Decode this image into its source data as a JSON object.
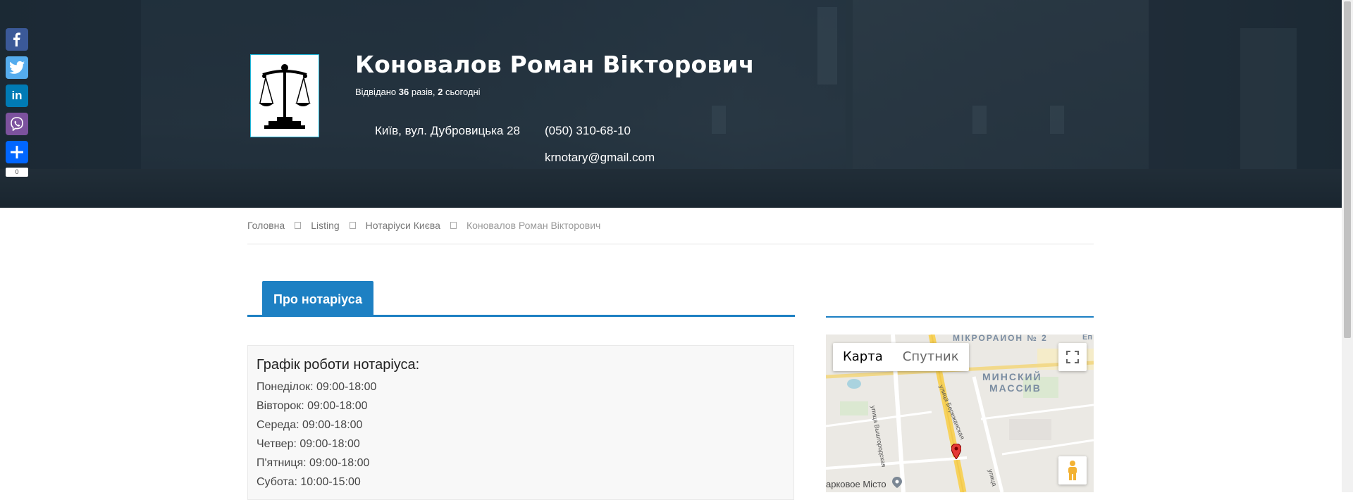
{
  "header": {
    "title": "Коновалов Роман Вікторович",
    "visits_prefix": "Відвідано ",
    "visits_total": "36",
    "visits_mid": " разів, ",
    "visits_today": "2",
    "visits_suffix": " сьогодні",
    "address": "Київ, вул. Дубровицька 28",
    "phone": "(050) 310-68-10",
    "email": "krnotary@gmail.com"
  },
  "social": {
    "buttons": [
      {
        "name": "facebook",
        "color": "#3b5998",
        "glyph": "f"
      },
      {
        "name": "twitter",
        "color": "#55acee",
        "glyph": "t"
      },
      {
        "name": "linkedin",
        "color": "#007bb5",
        "glyph": "in"
      },
      {
        "name": "viber",
        "color": "#7c529e",
        "glyph": "✆"
      },
      {
        "name": "share",
        "color": "#0166ff",
        "glyph": "+"
      }
    ],
    "share_count": "0"
  },
  "breadcrumb": {
    "home": "Головна",
    "listing": "Listing",
    "category": "Нотаріуси Києва",
    "current": "Коновалов Роман Вікторович"
  },
  "tabs": {
    "about": "Про нотаріуса"
  },
  "schedule": {
    "heading": "Графік роботи нотаріуса:",
    "days": [
      "Понеділок: 09:00-18:00",
      "Вівторок: 09:00-18:00",
      "Середа: 09:00-18:00",
      "Четвер: 09:00-18:00",
      "П'ятниця: 09:00-18:00",
      "Субота: 10:00-15:00"
    ]
  },
  "map": {
    "type_map": "Карта",
    "type_satellite": "Спутник",
    "district_top": "МІКРОРАЙОН № 2",
    "district_name_1": "МИНСКИЙ",
    "district_name_2": "МАССИВ",
    "street_1": "улица Вышгородская",
    "street_2": "улица Бережанская",
    "street_3": "улица",
    "place": "арковое Місто",
    "corner": "Еп"
  },
  "colors": {
    "accent": "#1d80c3",
    "logo_border": "#1fb6d9"
  }
}
